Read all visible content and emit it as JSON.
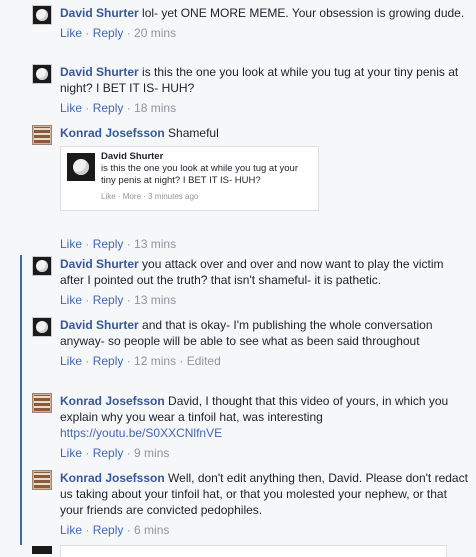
{
  "comments": [
    {
      "author": "David Shurter",
      "text": "lol- yet ONE MORE MEME. Your obsession is growing dude.",
      "like": "Like",
      "reply": "Reply",
      "time": "20 mins"
    },
    {
      "author": "David Shurter",
      "text": "is this the one you look at while you tug at your tiny penis at night? I BET IT IS- HUH?",
      "like": "Like",
      "reply": "Reply",
      "time": "18 mins"
    },
    {
      "author": "Konrad Josefsson",
      "text": "Shameful",
      "like": "Like",
      "reply": "Reply",
      "time": "13 mins",
      "quote": {
        "author": "David Shurter",
        "text": "is this the one you look at while you tug at your tiny penis at night? I BET IT IS- HUH?",
        "meta": "Like · More · 3 minutes ago"
      }
    },
    {
      "author": "David Shurter",
      "text": "you attack over and over and now want to play the victim after I pointed out the truth? that isn't shameful- it is pathetic.",
      "like": "Like",
      "reply": "Reply",
      "time": "13 mins"
    },
    {
      "author": "David Shurter",
      "text": "and that is okay- I'm publishing the whole conversation anyway- so people will be able to see what as been said throughout",
      "like": "Like",
      "reply": "Reply",
      "time": "12 mins",
      "edited": "Edited"
    },
    {
      "author": "Konrad Josefsson",
      "text": "David, I thought that this video of yours, in which you explain why you wear a tinfoil hat, was interesting",
      "link": "https://youtu.be/S0XXCNlfnVE",
      "like": "Like",
      "reply": "Reply",
      "time": "9 mins"
    },
    {
      "author": "Konrad Josefsson",
      "text": "Well, don't edit anything then, David. Please don't redact us taking about your tinfoil hat, or that you molested your nephew, or that your friends are convicted pedophiles.",
      "like": "Like",
      "reply": "Reply",
      "time": "6 mins"
    }
  ],
  "sep": " · "
}
